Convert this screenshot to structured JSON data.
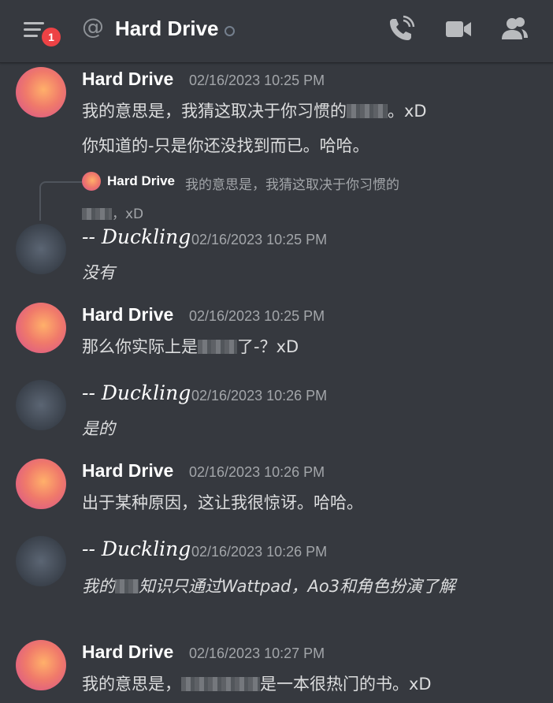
{
  "header": {
    "notification_count": "1",
    "at_symbol": "@",
    "title": "Hard Drive"
  },
  "reply": {
    "author": "Hard Drive",
    "text": "我的意思是，我猜这取决于你习惯的",
    "text2_after": "，xD"
  },
  "messages": [
    {
      "author": "Hard Drive",
      "time": "02/16/2023 10:25 PM",
      "line1_before": "我的意思是，我猜这取决于你习惯的",
      "line1_after": "。xD",
      "line2": "你知道的-只是你还没找到而已。哈哈。"
    },
    {
      "author": "-- Duckling",
      "time": "02/16/2023 10:25 PM",
      "text": "没有"
    },
    {
      "author": "Hard Drive",
      "time": "02/16/2023 10:25 PM",
      "text_before": "那么你实际上是",
      "text_after": "了-？xD"
    },
    {
      "author": "-- Duckling",
      "time": "02/16/2023 10:26 PM",
      "text": "是的"
    },
    {
      "author": "Hard Drive",
      "time": "02/16/2023 10:26 PM",
      "text": "出于某种原因，这让我很惊讶。哈哈。"
    },
    {
      "author": "-- Duckling",
      "time": "02/16/2023 10:26 PM",
      "text_before": "我的",
      "text_after": "知识只通过Wattpad，Ao3和角色扮演了解"
    },
    {
      "author": "Hard Drive",
      "time": "02/16/2023 10:27 PM",
      "text_before": "我的意思是，",
      "text_after": "是一本很热门的书。xD"
    }
  ]
}
